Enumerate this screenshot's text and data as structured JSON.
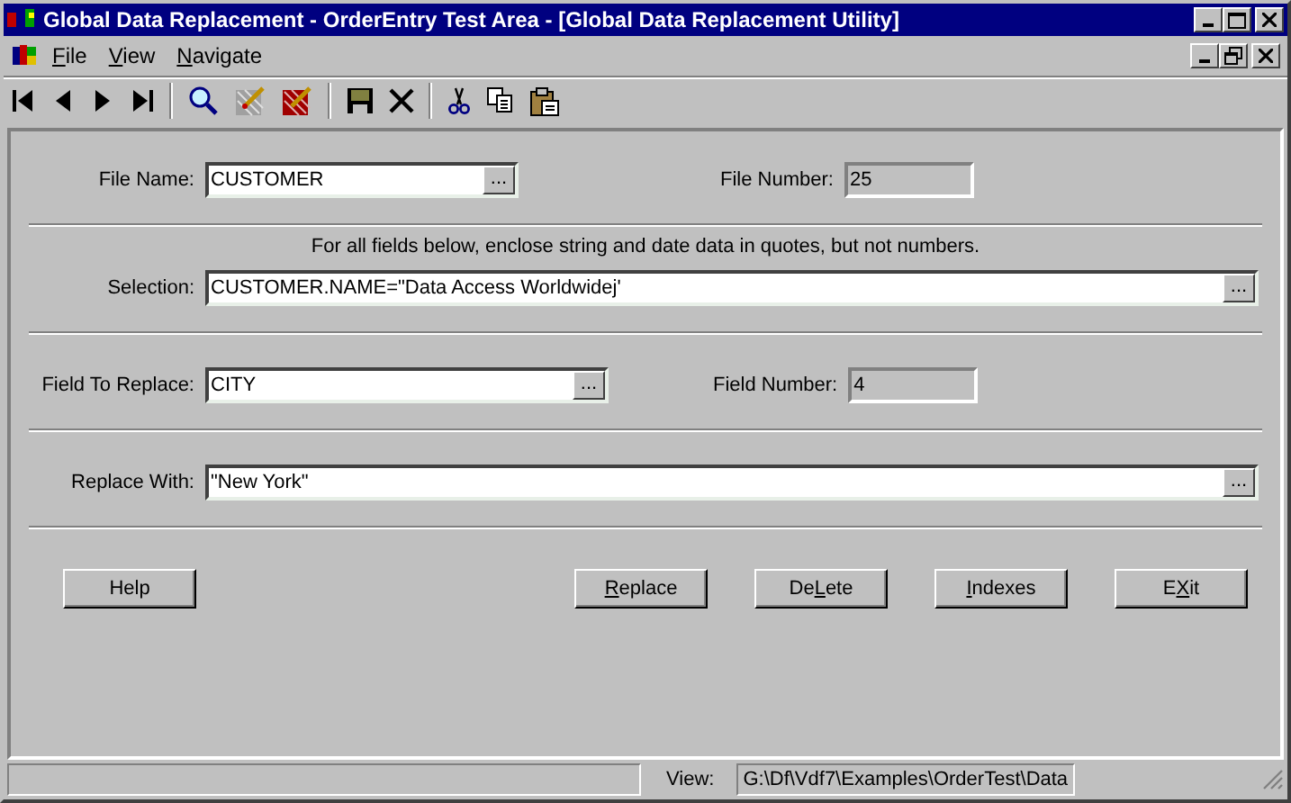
{
  "window": {
    "title": "Global Data Replacement - OrderEntry Test Area - [Global Data Replacement Utility]"
  },
  "menu": [
    {
      "access_key": "F",
      "text_after": "ile"
    },
    {
      "access_key": "V",
      "text_after": "iew"
    },
    {
      "access_key": "N",
      "text_after": "avigate"
    }
  ],
  "form": {
    "file_name": {
      "label": "File Name:",
      "value": "CUSTOMER",
      "read_only": false,
      "browse": "..."
    },
    "file_number": {
      "label": "File Number:",
      "value": "25",
      "read_only": true
    },
    "note": "For all fields below, enclose string and date data in quotes, but not numbers.",
    "selection": {
      "label": "Selection:",
      "value": "CUSTOMER.NAME=\"Data Access Worldwidej'",
      "read_only": false,
      "browse": "..."
    },
    "field_to_replace": {
      "label": "Field To Replace:",
      "value": "CITY",
      "read_only": false,
      "browse": "..."
    },
    "field_number": {
      "label": "Field Number:",
      "value": "4",
      "read_only": true
    },
    "replace_with": {
      "label": "Replace With:",
      "value": "\"New York\"",
      "read_only": false,
      "browse": "..."
    }
  },
  "buttons": [
    {
      "text_before": "Help"
    },
    {
      "access_key": "R",
      "text_after": "eplace"
    },
    {
      "text_before": "De",
      "access_key": "L",
      "text_after": "ete"
    },
    {
      "access_key": "I",
      "text_after": "ndexes"
    },
    {
      "text_before": "E",
      "access_key": "X",
      "text_after": "it"
    }
  ],
  "status_bar": {
    "view_label": "View:",
    "view_path": "G:\\Df\\Vdf7\\Examples\\OrderTest\\Data"
  }
}
